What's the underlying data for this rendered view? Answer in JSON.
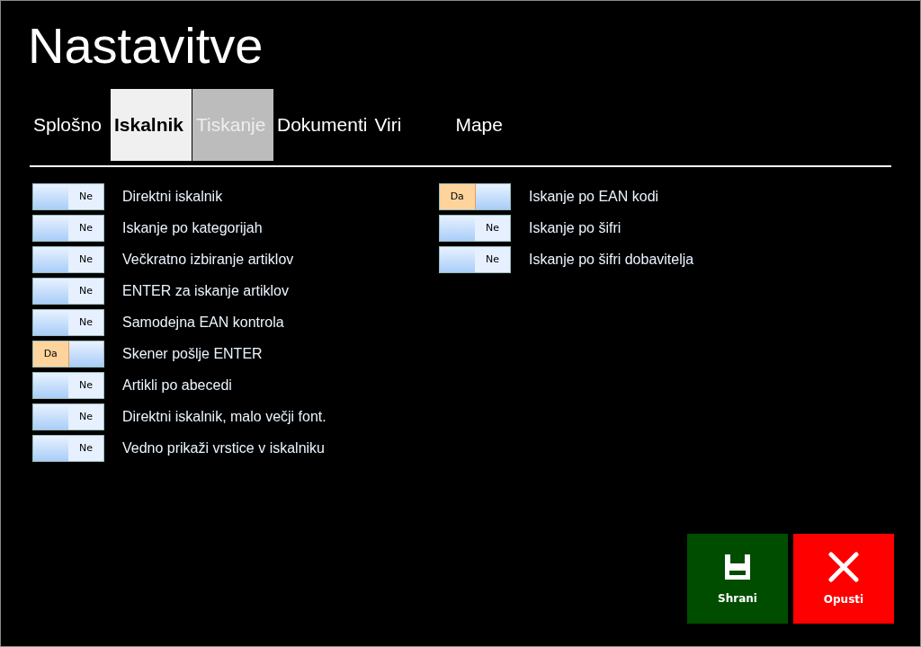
{
  "window": {
    "title": "Nastavitve"
  },
  "tabs": [
    {
      "label": "Splošno",
      "selected": false,
      "hovered": false
    },
    {
      "label": "Iskalnik",
      "selected": true,
      "hovered": false
    },
    {
      "label": "Tiskanje",
      "selected": false,
      "hovered": true
    },
    {
      "label": "Dokumenti",
      "selected": false,
      "hovered": false
    },
    {
      "label": "Viri",
      "selected": false,
      "hovered": false
    },
    {
      "label": "Mape",
      "selected": false,
      "hovered": false
    }
  ],
  "columns": [
    [
      {
        "label": "Direktni iskalnik",
        "on": false,
        "state_text": "Ne"
      },
      {
        "label": "Iskanje po kategorijah",
        "on": false,
        "state_text": "Ne"
      },
      {
        "label": "Večkratno izbiranje artiklov",
        "on": false,
        "state_text": "Ne"
      },
      {
        "label": "ENTER za iskanje artiklov",
        "on": false,
        "state_text": "Ne"
      },
      {
        "label": "Samodejna EAN kontrola",
        "on": false,
        "state_text": "Ne"
      },
      {
        "label": "Skener pošlje ENTER",
        "on": true,
        "state_text": "Da"
      },
      {
        "label": "Artikli po abecedi",
        "on": false,
        "state_text": "Ne"
      },
      {
        "label": "Direktni iskalnik, malo večji font.",
        "on": false,
        "state_text": "Ne"
      },
      {
        "label": "Vedno prikaži vrstice v iskalniku",
        "on": false,
        "state_text": "Ne"
      }
    ],
    [
      {
        "label": "Iskanje po EAN kodi",
        "on": true,
        "state_text": "Da"
      },
      {
        "label": "Iskanje po šifri",
        "on": false,
        "state_text": "Ne"
      },
      {
        "label": "Iskanje po šifri dobavitelja",
        "on": false,
        "state_text": "Ne"
      }
    ]
  ],
  "buttons": [
    {
      "label": "Shrani",
      "kind": "save"
    },
    {
      "label": "Opusti",
      "kind": "cancel"
    }
  ]
}
